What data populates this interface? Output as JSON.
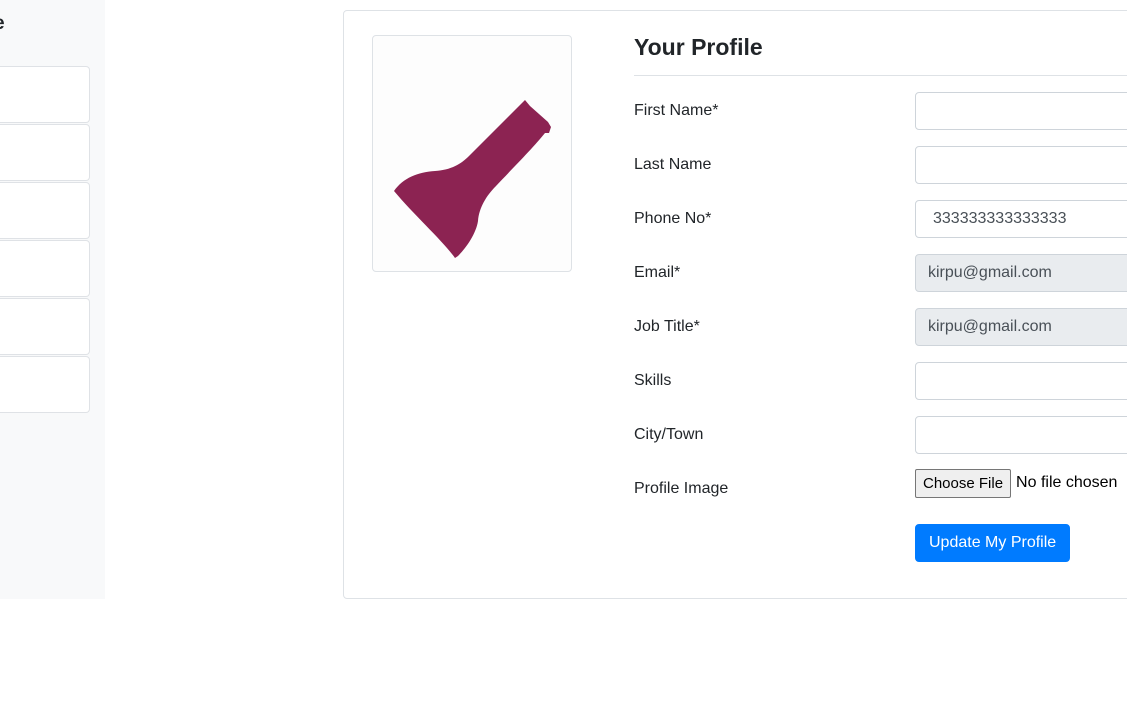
{
  "sidebar": {
    "title": "e",
    "items": [
      {
        "label": ""
      },
      {
        "label": ""
      },
      {
        "label": ""
      },
      {
        "label": ""
      },
      {
        "label": ""
      },
      {
        "label": ""
      }
    ]
  },
  "profile": {
    "title": "Your Profile",
    "fields": {
      "first_name": {
        "label": "First Name*",
        "value": ""
      },
      "last_name": {
        "label": "Last Name",
        "value": ""
      },
      "phone": {
        "label": "Phone No*",
        "value": "333333333333333"
      },
      "email": {
        "label": "Email*",
        "value": "kirpu@gmail.com"
      },
      "job_title": {
        "label": "Job Title*",
        "value": "kirpu@gmail.com"
      },
      "skills": {
        "label": "Skills",
        "value": ""
      },
      "city": {
        "label": "City/Town",
        "value": ""
      },
      "profile_image": {
        "label": "Profile Image",
        "button": "Choose File",
        "status": "No file chosen"
      }
    },
    "submit_label": "Update My Profile"
  },
  "colors": {
    "accent": "#007bff",
    "avatar_shape": "#8c2352",
    "readonly_bg": "#e9ecef",
    "sidebar_bg": "#f8f9fa"
  },
  "icons": {
    "avatar": "user-avatar-image"
  }
}
